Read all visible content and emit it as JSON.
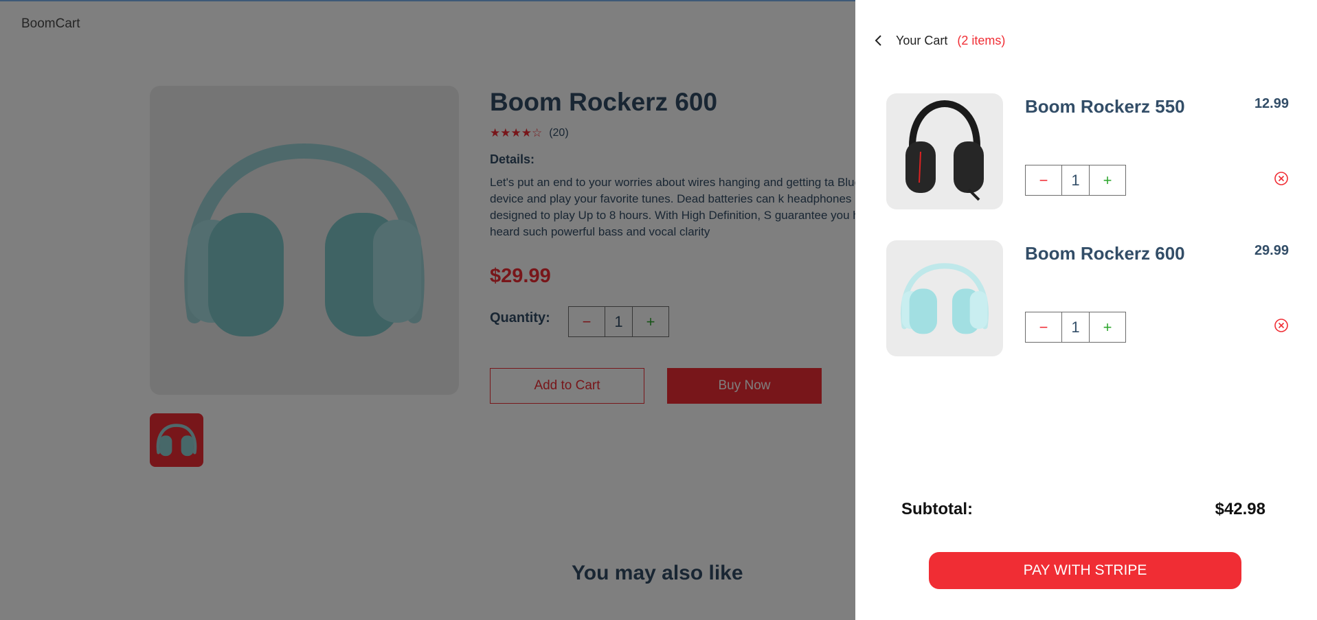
{
  "header": {
    "logo": "BoomCart"
  },
  "product": {
    "title": "Boom Rockerz 600",
    "stars": "★★★★☆",
    "review_count": "(20)",
    "details_heading": "Details:",
    "details_text": "Let's put an end to your worries about wires hanging and getting ta Bluetooth device and play your favorite tunes. Dead batteries can k headphones designed to play Up to 8 hours. With High Definition, S guarantee you have not heard such powerful bass and vocal clarity",
    "price": "$29.99",
    "quantity_label": "Quantity:",
    "quantity": "1",
    "add_to_cart": "Add to Cart",
    "buy_now": "Buy Now"
  },
  "also_like": {
    "title": "You may also like"
  },
  "cart": {
    "heading": "Your Cart",
    "count": "(2 items)",
    "items": [
      {
        "name": "Boom Rockerz 550",
        "price": "12.99",
        "quantity": "1",
        "image_icon": "black-headphones-icon"
      },
      {
        "name": "Boom Rockerz 600",
        "price": "29.99",
        "quantity": "1",
        "image_icon": "teal-headphones-icon"
      }
    ],
    "subtotal_label": "Subtotal:",
    "subtotal_value": "$42.98",
    "pay_button": "PAY WITH STRIPE"
  },
  "icons": {
    "minus": "−",
    "plus": "+"
  },
  "colors": {
    "accent": "#f02d34",
    "text": "#324d67",
    "plus_green": "#31a831"
  }
}
